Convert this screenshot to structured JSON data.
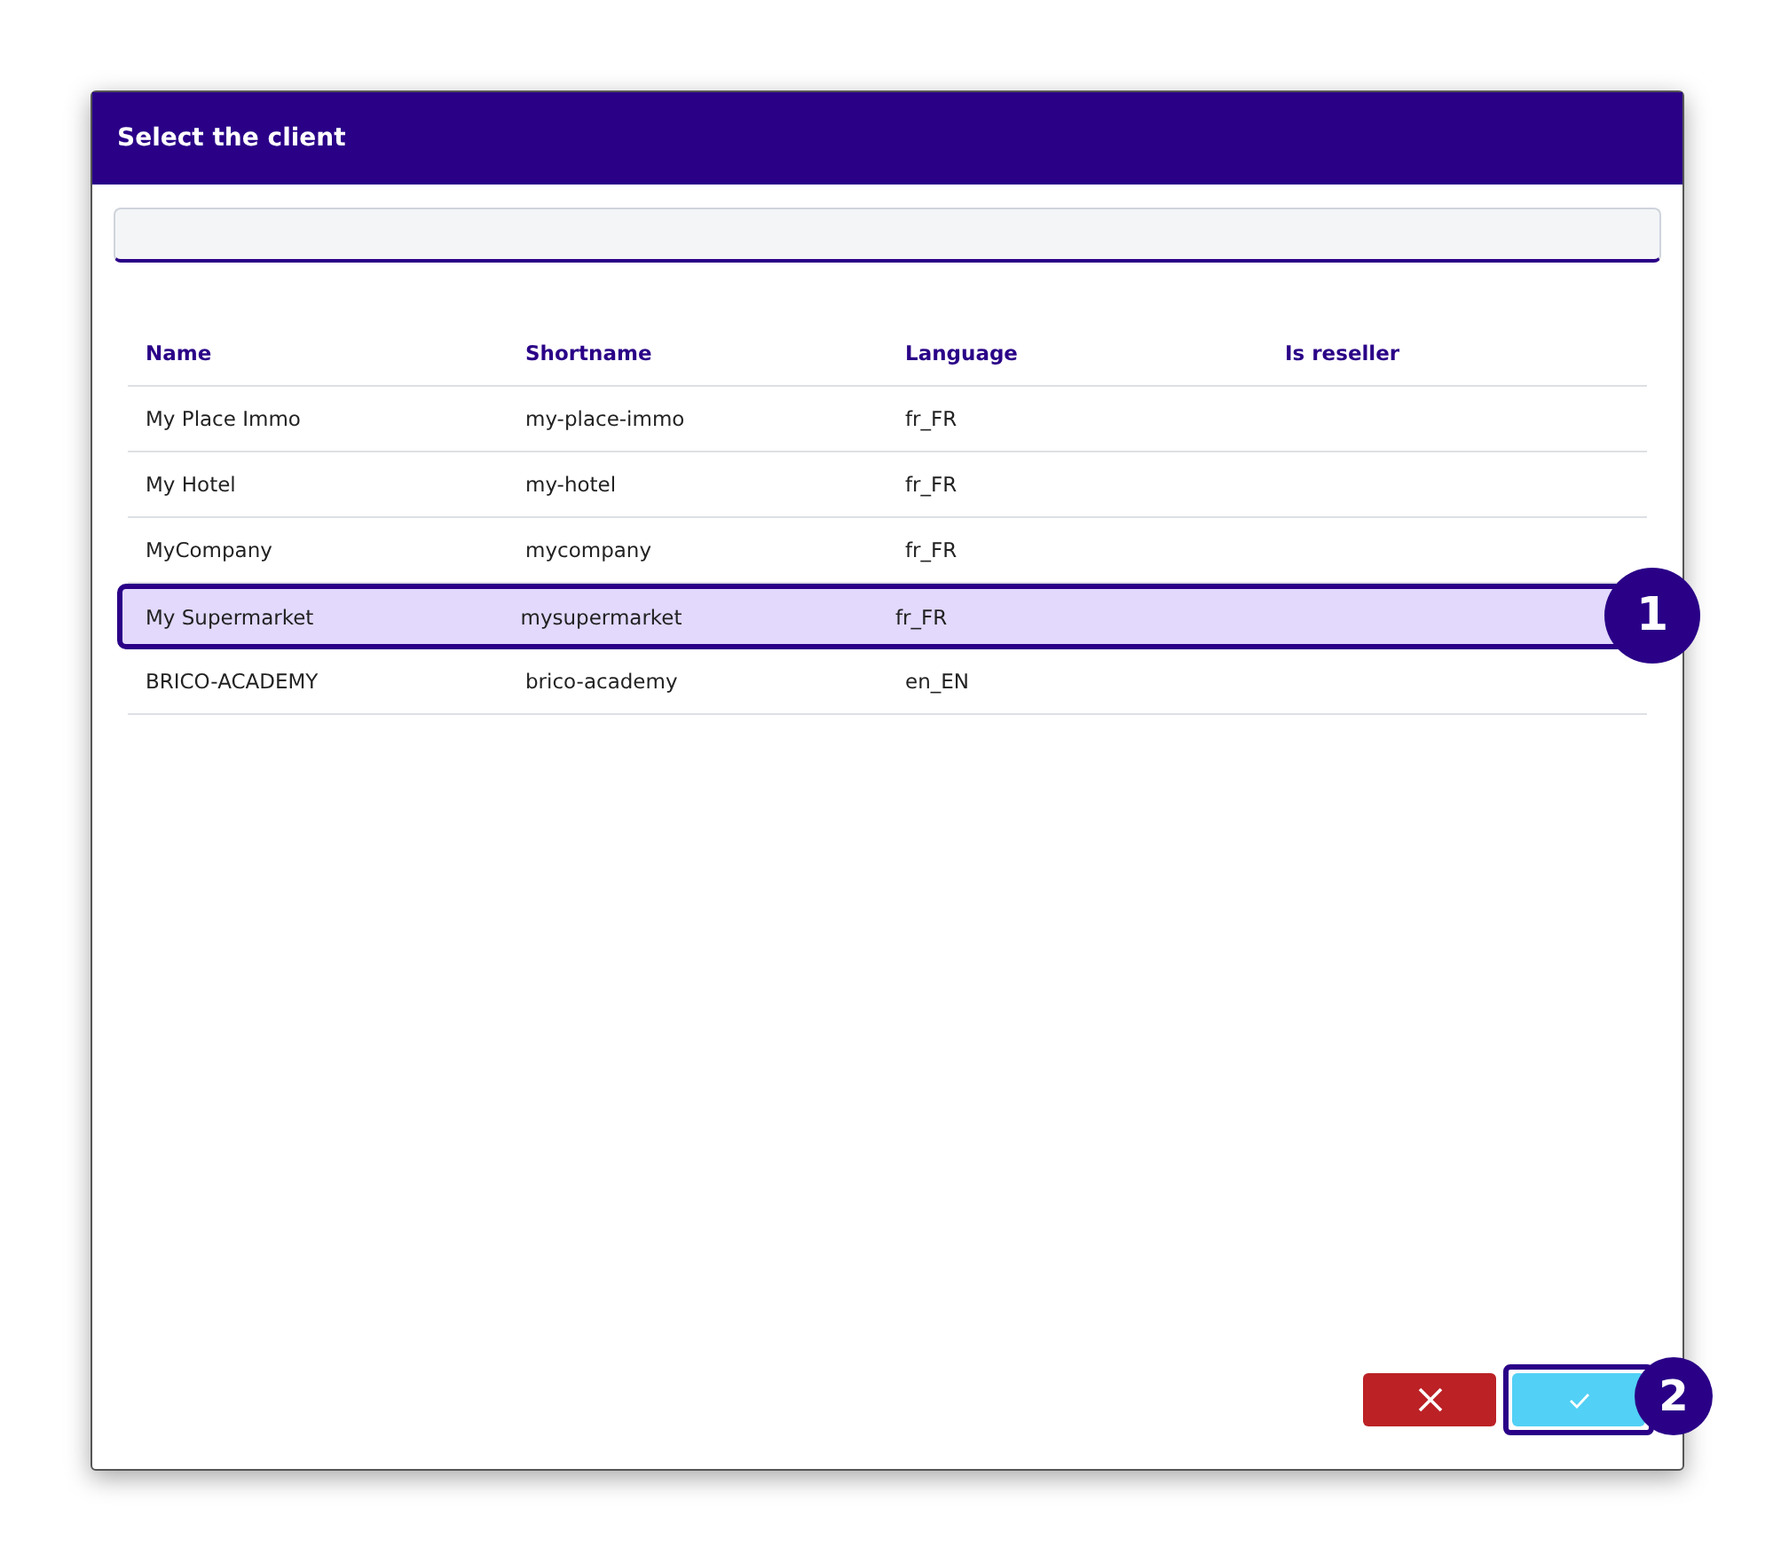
{
  "dialog": {
    "title": "Select the client"
  },
  "table": {
    "columns": [
      "Name",
      "Shortname",
      "Language",
      "Is reseller"
    ],
    "rows": [
      {
        "cells": [
          "My Place Immo",
          "my-place-immo",
          "fr_FR"
        ],
        "selected": false
      },
      {
        "cells": [
          "My Hotel",
          "my-hotel",
          "fr_FR"
        ],
        "selected": false
      },
      {
        "cells": [
          "MyCompany",
          "mycompany",
          "fr_FR"
        ],
        "selected": false
      },
      {
        "cells": [
          "My Supermarket",
          "mysupermarket",
          "fr_FR"
        ],
        "selected": true,
        "callout": "1"
      },
      {
        "cells": [
          "BRICO-ACADEMY",
          "brico-academy",
          "en_EN"
        ],
        "selected": false
      }
    ]
  },
  "buttons": [
    {
      "kind": "cancel"
    },
    {
      "kind": "confirm",
      "callout": "2"
    }
  ]
}
